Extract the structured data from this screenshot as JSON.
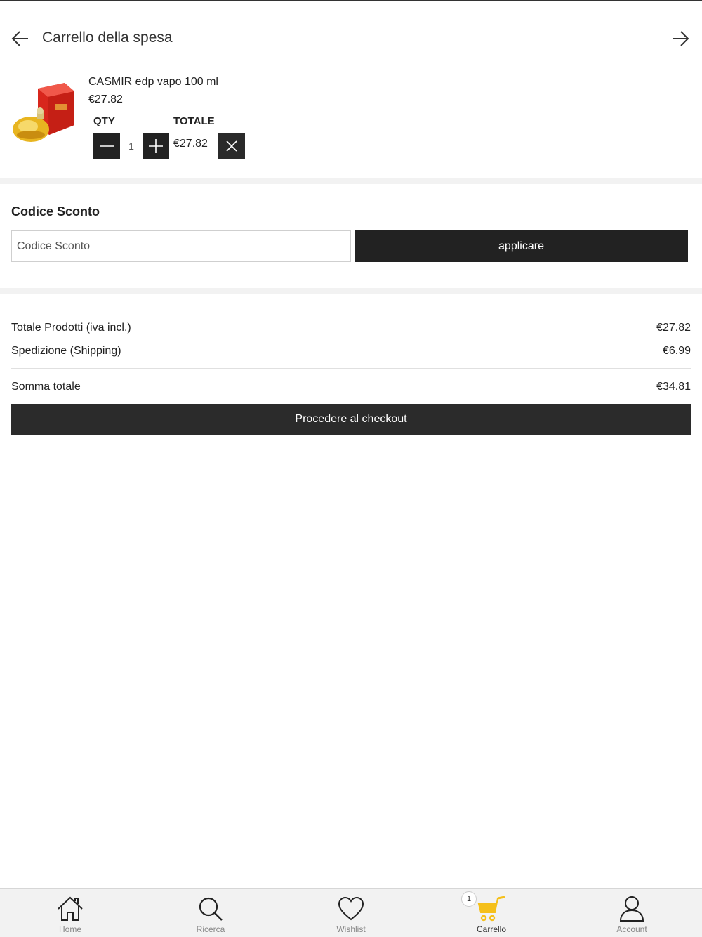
{
  "header": {
    "title": "Carrello della spesa"
  },
  "cart": {
    "item": {
      "name": "CASMIR edp vapo 100 ml",
      "price": "€27.82",
      "qty_label": "QTY",
      "total_label": "TOTALE",
      "quantity": "1",
      "line_total": "€27.82"
    }
  },
  "coupon": {
    "title": "Codice Sconto",
    "placeholder": "Codice Sconto",
    "apply_label": "applicare"
  },
  "totals": {
    "products_label": "Totale Prodotti (iva incl.)",
    "products_value": "€27.82",
    "shipping_label": "Spedizione (Shipping)",
    "shipping_value": "€6.99",
    "sum_label": "Somma totale",
    "sum_value": "€34.81",
    "checkout_label": "Procedere al checkout"
  },
  "nav": {
    "items": [
      {
        "label": "Home",
        "icon": "home-icon"
      },
      {
        "label": "Ricerca",
        "icon": "search-icon"
      },
      {
        "label": "Wishlist",
        "icon": "heart-icon"
      },
      {
        "label": "Carrello",
        "icon": "cart-icon",
        "badge": "1",
        "active": true
      },
      {
        "label": "Account",
        "icon": "user-icon"
      }
    ],
    "accent_color": "#f5c01b"
  }
}
